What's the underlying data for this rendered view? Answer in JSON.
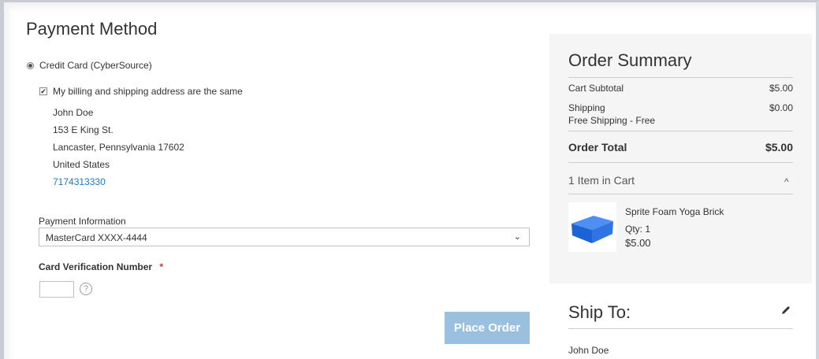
{
  "payment": {
    "title": "Payment Method",
    "method_label": "Credit Card (CyberSource)",
    "same_address_label": "My billing and shipping address are the same",
    "address": {
      "name": "John Doe",
      "street": "153 E King St.",
      "city_line": "Lancaster, Pennsylvania 17602",
      "country": "United States",
      "phone": "7174313330"
    },
    "info_label": "Payment Information",
    "selected_card": "MasterCard XXXX-4444",
    "cvv_label": "Card Verification Number",
    "required_mark": "*",
    "help_glyph": "?",
    "place_order": "Place Order"
  },
  "summary": {
    "title": "Order Summary",
    "subtotal_label": "Cart Subtotal",
    "subtotal_value": "$5.00",
    "shipping_label": "Shipping",
    "shipping_method": "Free Shipping - Free",
    "shipping_value": "$0.00",
    "total_label": "Order Total",
    "total_value": "$5.00",
    "items_label": "1 Item in Cart",
    "item": {
      "name": "Sprite Foam Yoga Brick",
      "qty": "Qty: 1",
      "price": "$5.00"
    }
  },
  "ship_to": {
    "title": "Ship To:",
    "name": "John Doe"
  },
  "icons": {
    "caret_up": "^",
    "chevron_down": "⌄",
    "check": "✔"
  },
  "colors": {
    "link": "#1979c3",
    "button": "#9ac0e0",
    "required": "#e02b27",
    "panel": "#f5f5f5"
  }
}
